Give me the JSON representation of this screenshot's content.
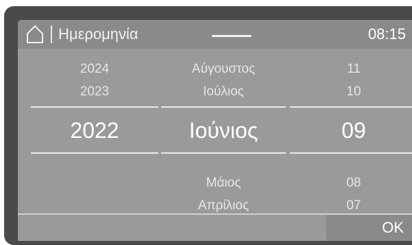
{
  "header": {
    "title": "Ημερομηνία",
    "time": "08:15",
    "home_icon": "home-icon"
  },
  "picker": {
    "year": {
      "above": [
        "2024",
        "2023"
      ],
      "selected": "2022",
      "below": [
        "",
        ""
      ]
    },
    "month": {
      "above": [
        "Αύγουστος",
        "Ιούλιος"
      ],
      "selected": "Ιούνιος",
      "below": [
        "Μάιος",
        "Απρίλιος"
      ]
    },
    "day": {
      "above": [
        "11",
        "10"
      ],
      "selected": "09",
      "below": [
        "08",
        "07"
      ]
    }
  },
  "footer": {
    "ok_label": "OK"
  },
  "colors": {
    "bezel": "#4a4a4a",
    "screen": "#9a9a9a",
    "header": "#8a8a8a",
    "text": "#ffffff"
  }
}
